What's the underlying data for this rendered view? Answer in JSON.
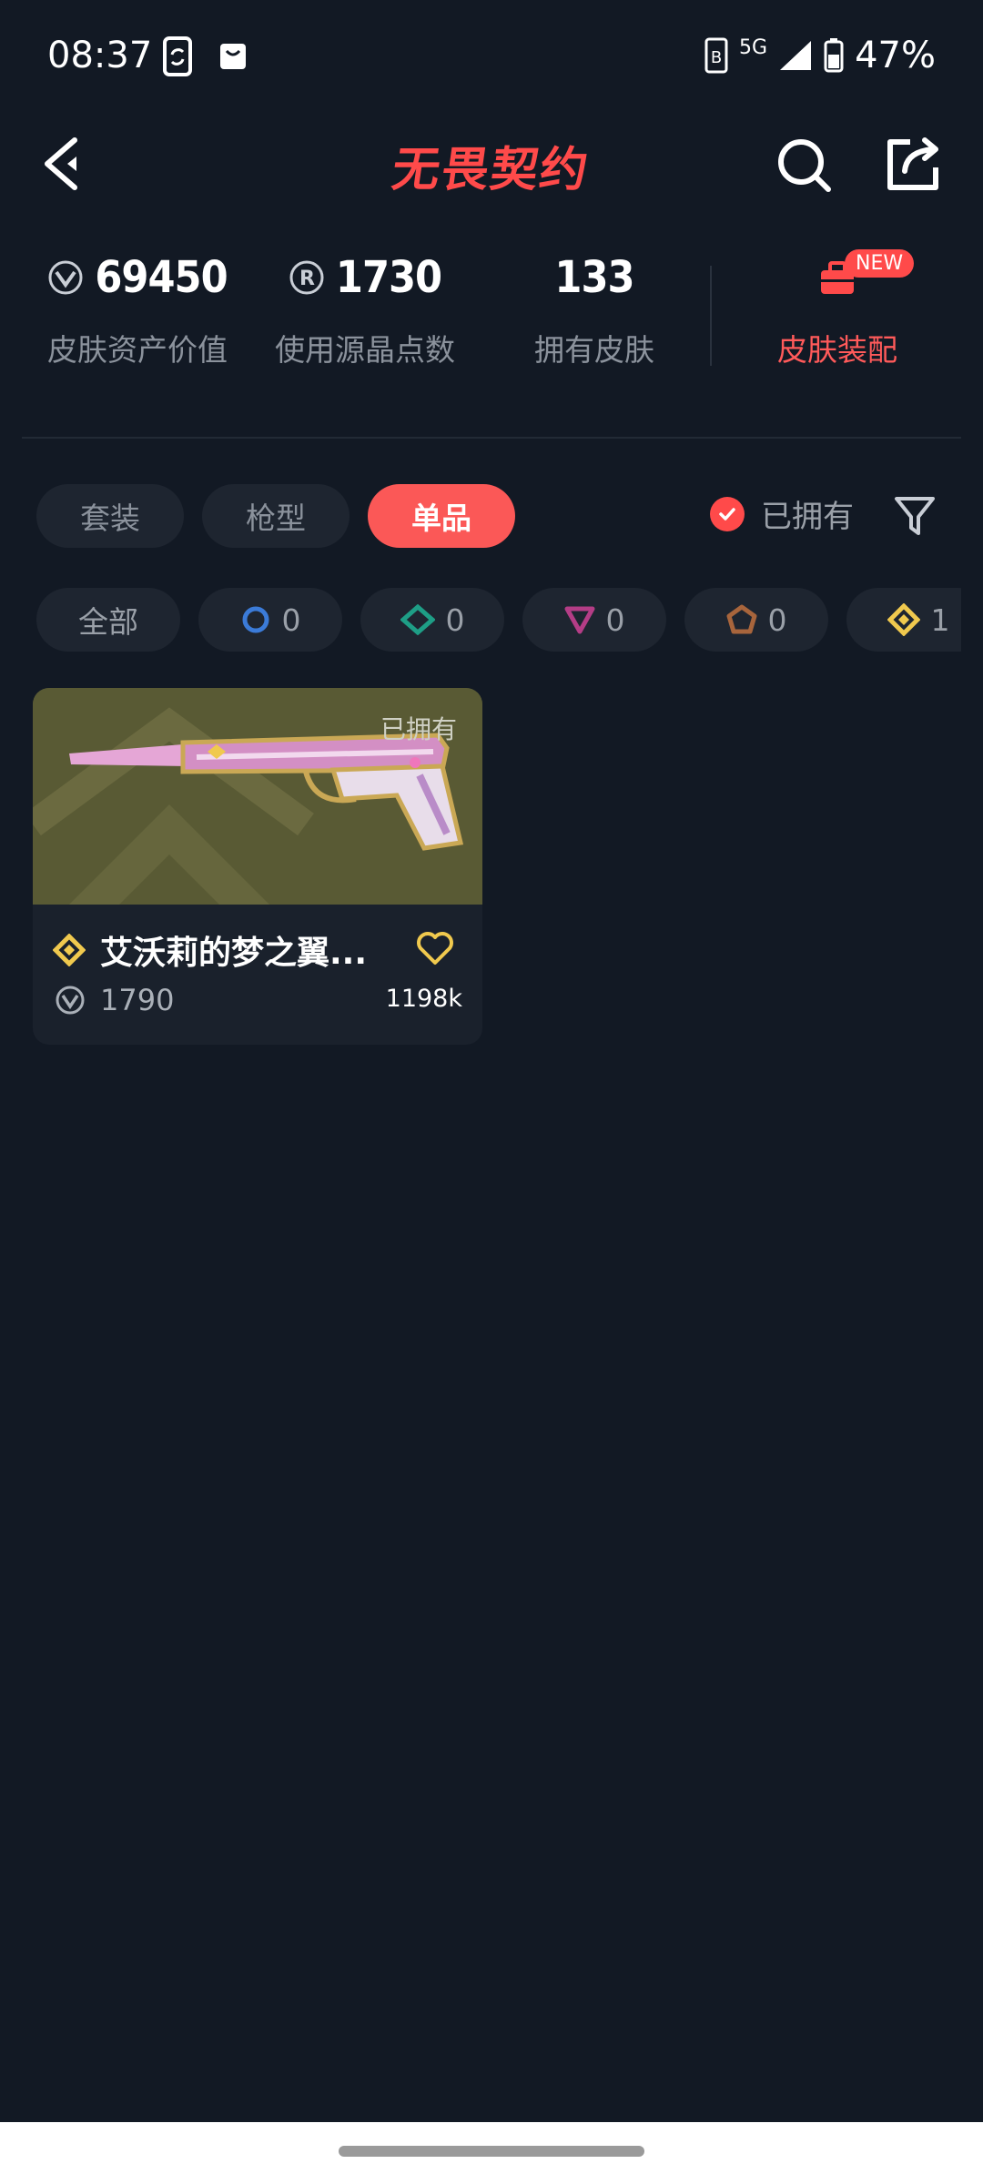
{
  "status_bar": {
    "time": "08:37",
    "network": "5G",
    "battery": "47%"
  },
  "header": {
    "title": "无畏契约"
  },
  "stats": [
    {
      "value": "69450",
      "label": "皮肤资产价值",
      "icon": "valorant-points-icon"
    },
    {
      "value": "1730",
      "label": "使用源晶点数",
      "icon": "radianite-icon"
    },
    {
      "value": "133",
      "label": "拥有皮肤"
    }
  ],
  "equip": {
    "label": "皮肤装配",
    "badge": "NEW",
    "icon": "toolbox-icon"
  },
  "tabs": [
    "套装",
    "枪型",
    "单品"
  ],
  "active_tab": "单品",
  "owned_filter": {
    "label": "已拥有",
    "checked": true
  },
  "rarity_chips": [
    {
      "label": "全部"
    },
    {
      "count": "0",
      "icon": "select-tier-icon",
      "color": "#3b7bd8"
    },
    {
      "count": "0",
      "icon": "deluxe-tier-icon",
      "color": "#1e9e86"
    },
    {
      "count": "0",
      "icon": "premium-tier-icon",
      "color": "#b43d86"
    },
    {
      "count": "0",
      "icon": "ultra-tier-icon",
      "color": "#a8653c"
    },
    {
      "count": "1",
      "icon": "exclusive-tier-icon",
      "color": "#f0c94e"
    }
  ],
  "skins": [
    {
      "name": "艾沃莉的梦之翼...",
      "owned_tag": "已拥有",
      "price": "1790",
      "likes": "1198k",
      "tier_icon": "exclusive-tier-icon"
    }
  ],
  "colors": {
    "accent": "#fb5857",
    "background": "#121924",
    "chip": "#1e2530"
  }
}
